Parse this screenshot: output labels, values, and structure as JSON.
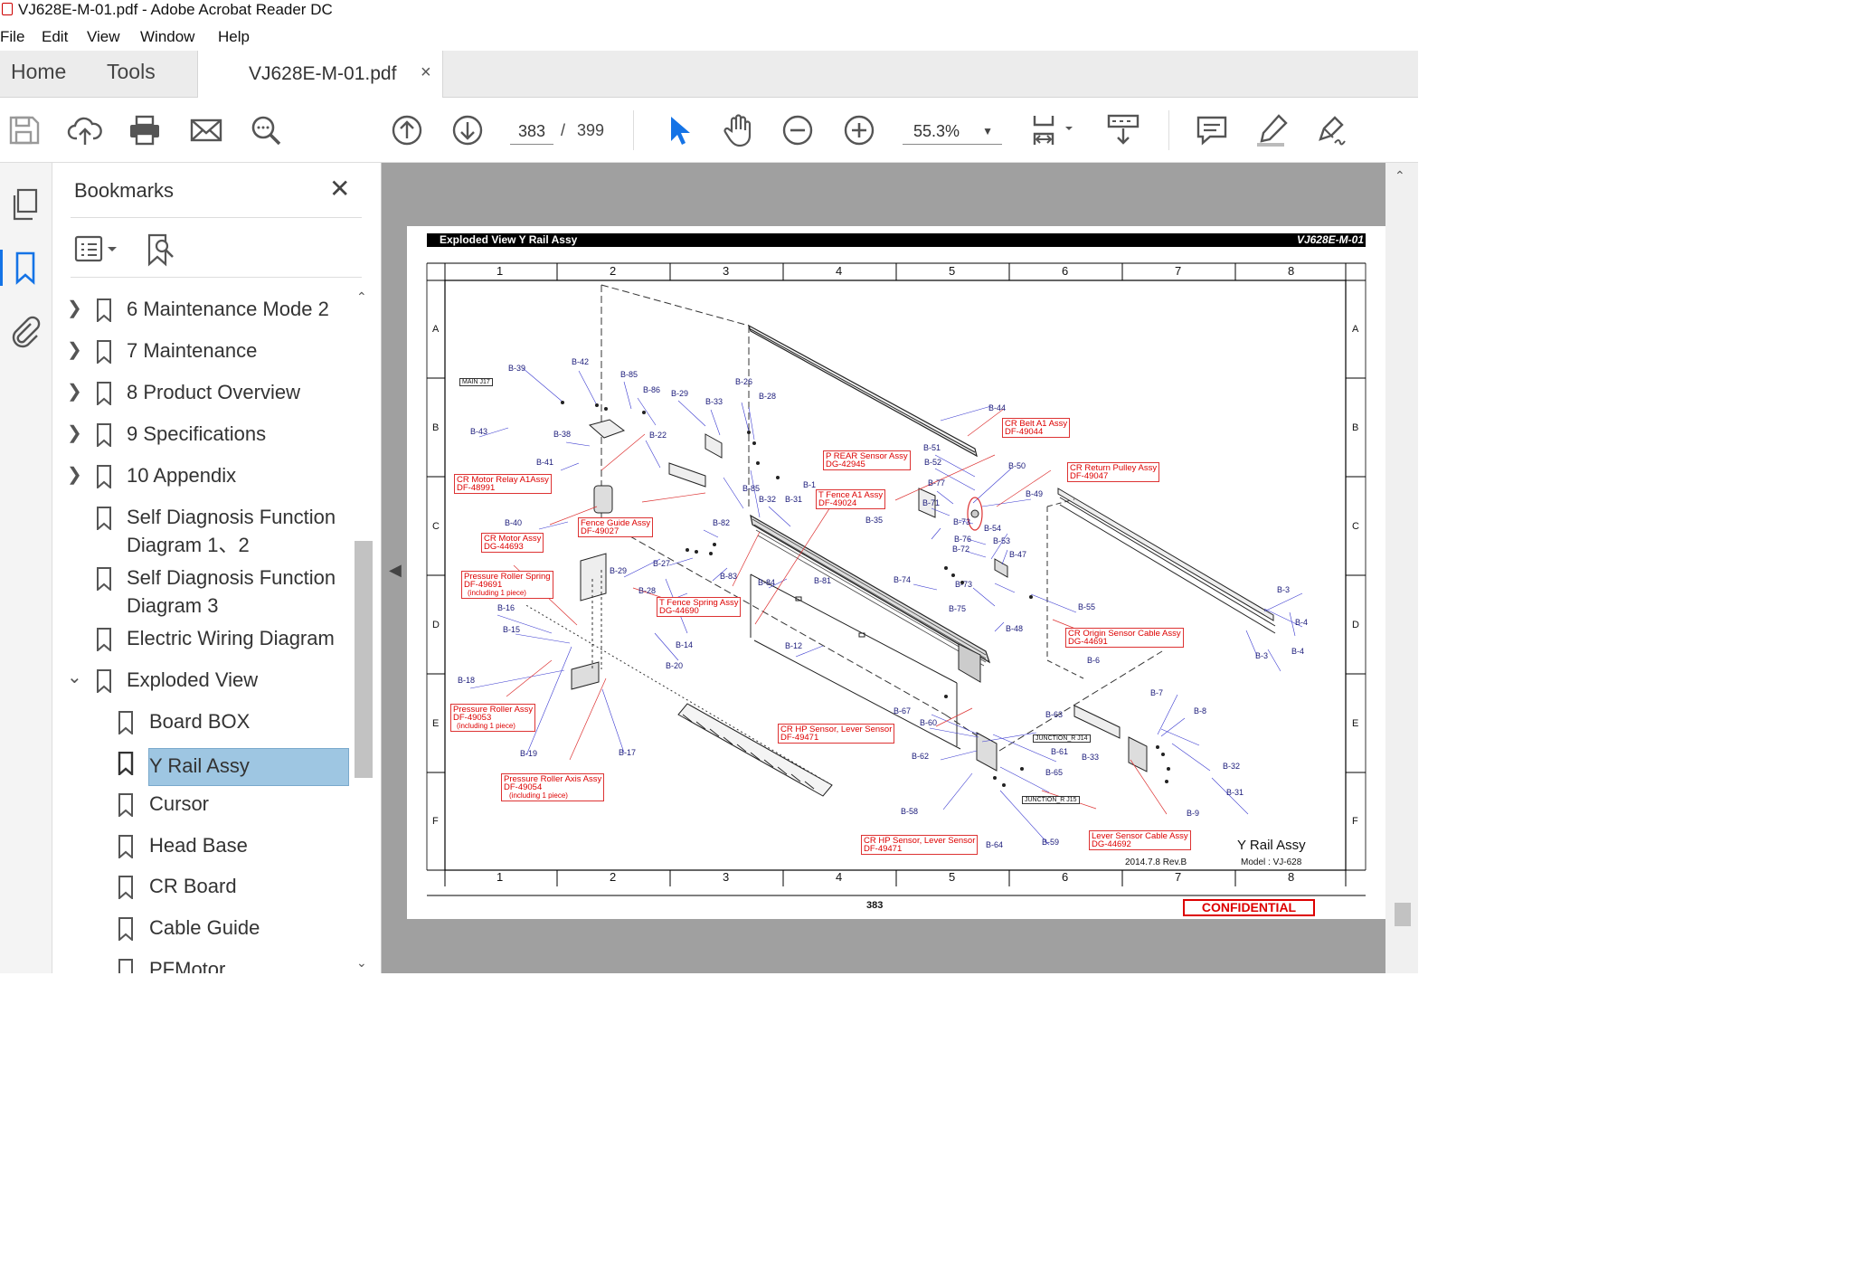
{
  "window": {
    "title": "VJ628E-M-01.pdf - Adobe Acrobat Reader DC"
  },
  "menu": [
    "File",
    "Edit",
    "View",
    "Window",
    "Help"
  ],
  "tabs": {
    "home": "Home",
    "tools": "Tools",
    "document": "VJ628E-M-01.pdf",
    "close": "×"
  },
  "toolbar": {
    "page_current": "383",
    "page_sep": "/",
    "page_total": "399",
    "zoom": "55.3%"
  },
  "bookmarks": {
    "title": "Bookmarks",
    "close": "✕",
    "items": [
      {
        "label": "6 Maintenance Mode 2",
        "expandable": true
      },
      {
        "label": "7 Maintenance",
        "expandable": true
      },
      {
        "label": "8 Product Overview",
        "expandable": true
      },
      {
        "label": "9 Specifications",
        "expandable": true
      },
      {
        "label": "10 Appendix",
        "expandable": true
      },
      {
        "label": "Self Diagnosis Function",
        "label2": "Diagram 1、2"
      },
      {
        "label": "Self Diagnosis Function",
        "label2": "Diagram 3"
      },
      {
        "label": "Electric Wiring Diagram"
      },
      {
        "label": "Exploded View",
        "expanded": true
      },
      {
        "label": "Board BOX",
        "child": true
      },
      {
        "label": "Y Rail Assy",
        "child": true,
        "selected": true
      },
      {
        "label": "Cursor",
        "child": true
      },
      {
        "label": "Head Base",
        "child": true
      },
      {
        "label": "CR Board",
        "child": true
      },
      {
        "label": "Cable Guide",
        "child": true
      },
      {
        "label": "PFMotor",
        "child": true
      }
    ]
  },
  "sheet": {
    "header_left": "Exploded View Y Rail Assy",
    "header_right": "VJ628E-M-01",
    "columns": [
      "1",
      "2",
      "3",
      "4",
      "5",
      "6",
      "7",
      "8"
    ],
    "rows": [
      "A",
      "B",
      "C",
      "D",
      "E",
      "F"
    ],
    "title": "Y Rail Assy",
    "model": "Model : VJ-628",
    "date": "2014.7.8 Rev.B",
    "page_number": "383",
    "confidential": "CONFIDENTIAL",
    "callouts": [
      {
        "l1": "CR Belt A1 Assy",
        "l2": "DF-49044"
      },
      {
        "l1": "P REAR Sensor Assy",
        "l2": "DG-42945"
      },
      {
        "l1": "CR Return Pulley Assy",
        "l2": "DF-49047"
      },
      {
        "l1": "T Fence A1 Assy",
        "l2": "DF-49024"
      },
      {
        "l1": "CR Motor Relay A1Assy",
        "l2": "DF-48991"
      },
      {
        "l1": "Fence Guide Assy",
        "l2": "DF-49027"
      },
      {
        "l1": "CR Motor Assy",
        "l2": "DG-44693"
      },
      {
        "l1": "Pressure Roller Spring",
        "l2": "DF-49691",
        "l3": "(including 1 piece)"
      },
      {
        "l1": "T Fence Spring Assy",
        "l2": "DG-44690"
      },
      {
        "l1": "CR Origin Sensor Cable Assy",
        "l2": "DG-44691"
      },
      {
        "l1": "Pressure Roller Assy",
        "l2": "DF-49053",
        "l3": "(including 1 piece)"
      },
      {
        "l1": "CR HP Sensor, Lever Sensor",
        "l2": "DF-49471"
      },
      {
        "l1": "Pressure Roller Axis Assy",
        "l2": "DF-49054",
        "l3": "(including 1 piece)"
      },
      {
        "l1": "CR HP Sensor, Lever Sensor",
        "l2": "DF-49471"
      },
      {
        "l1": "Lever Sensor Cable Assy",
        "l2": "DG-44692"
      }
    ],
    "part_labels": [
      "B-39",
      "B-42",
      "B-85",
      "B-86",
      "B-29",
      "B-26",
      "B-28",
      "B-33",
      "B-43",
      "B-38",
      "B-22",
      "B-41",
      "B-85",
      "B-32",
      "B-31",
      "B-1",
      "B-40",
      "B-82",
      "B-29",
      "B-27",
      "B-83",
      "B-84",
      "B-81",
      "B-28",
      "B-16",
      "B-15",
      "B-14",
      "B-20",
      "B-12",
      "B-18",
      "B-19",
      "B-17",
      "B-44",
      "B-51",
      "B-52",
      "B-50",
      "B-49",
      "B-77",
      "B-71",
      "B-35",
      "B-73",
      "B-76",
      "B-72",
      "B-54",
      "B-53",
      "B-47",
      "B-74",
      "B-73",
      "B-75",
      "B-48",
      "B-55",
      "B-3",
      "B-4",
      "B-4",
      "B-3",
      "B-6",
      "B-7",
      "B-8",
      "B-63",
      "B-67",
      "B-60",
      "B-62",
      "B-61",
      "B-65",
      "B-33",
      "B-32",
      "B-31",
      "B-9",
      "B-58",
      "B-64",
      "B-59"
    ],
    "connectors": [
      "MAIN J17",
      "JUNCTION_R J14",
      "JUNCTION_R J15"
    ]
  }
}
